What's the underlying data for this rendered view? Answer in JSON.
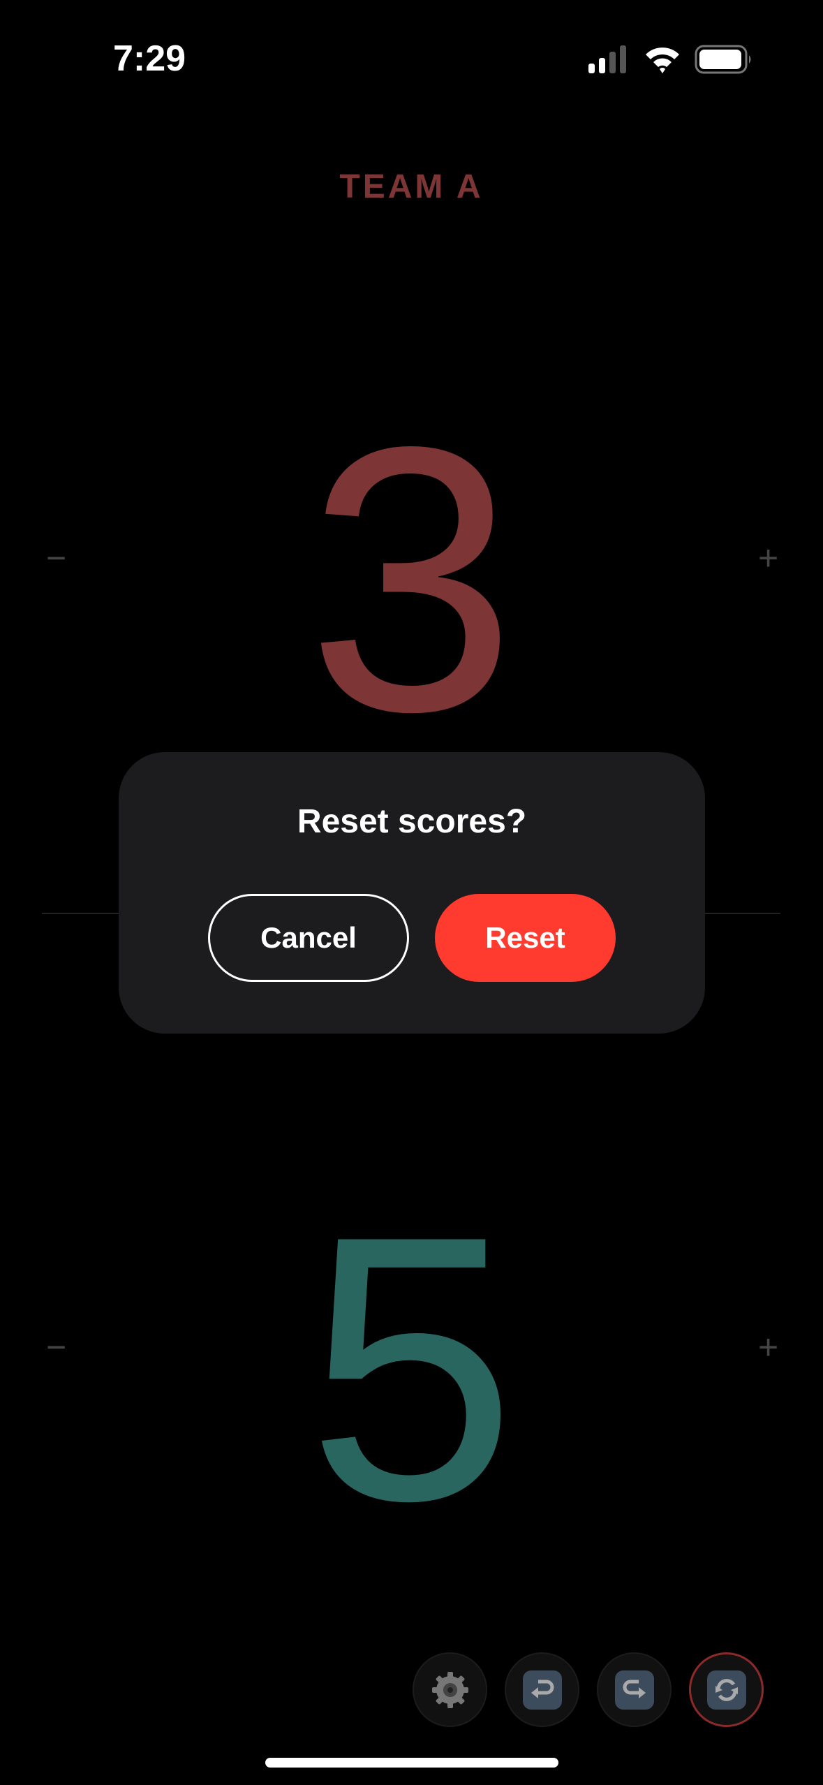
{
  "status_bar": {
    "time": "7:29",
    "icons": [
      "cellular-signal-icon",
      "wifi-icon",
      "battery-icon"
    ]
  },
  "team_a": {
    "label": "TEAM A",
    "score": "3",
    "color": "#7d3535",
    "decrement": "−",
    "increment": "+"
  },
  "team_b": {
    "score": "5",
    "color": "#2a6660",
    "decrement": "−",
    "increment": "+"
  },
  "dialog": {
    "title": "Reset scores?",
    "cancel_label": "Cancel",
    "reset_label": "Reset",
    "reset_color": "#ff3b30"
  },
  "toolbar": {
    "buttons": [
      "gear-icon",
      "undo-icon",
      "redo-icon",
      "reset-icon"
    ],
    "active": "reset-icon"
  }
}
